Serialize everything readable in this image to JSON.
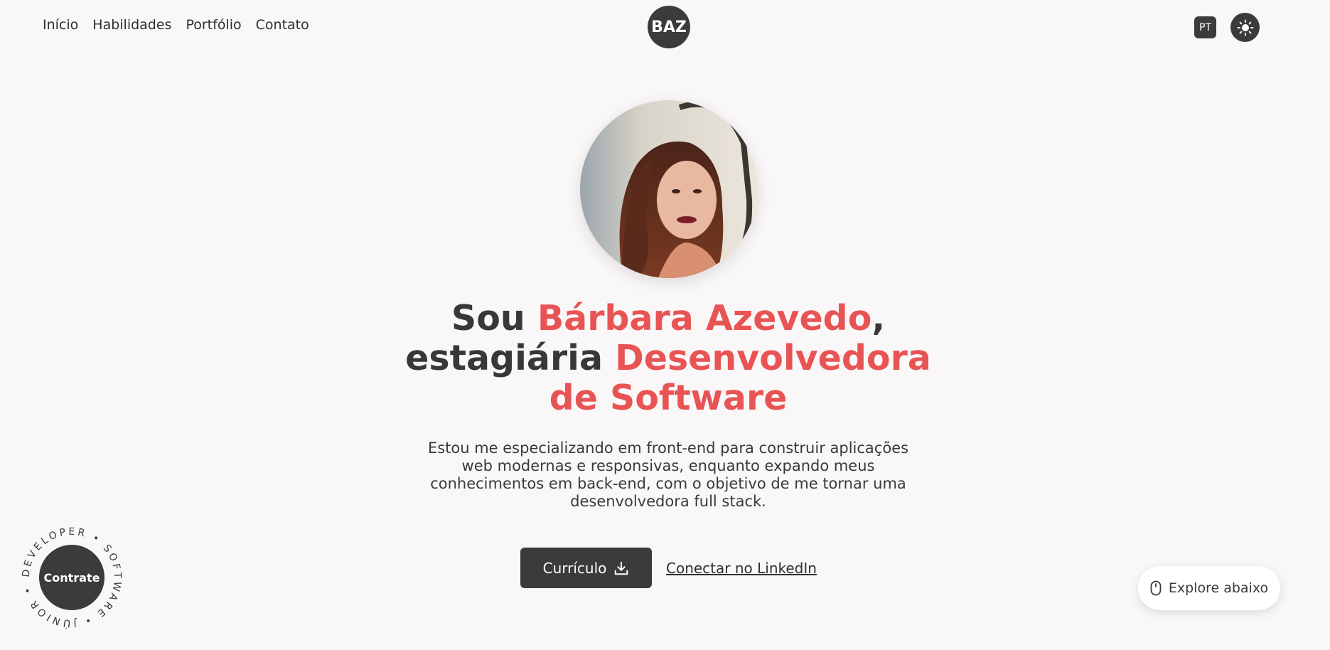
{
  "nav": {
    "items": [
      {
        "label": "Início"
      },
      {
        "label": "Habilidades"
      },
      {
        "label": "Portfólio"
      },
      {
        "label": "Contato"
      }
    ]
  },
  "logo": {
    "text": "BAZ"
  },
  "header": {
    "language_label": "PT",
    "theme_icon": "sun-icon"
  },
  "hero": {
    "headline": {
      "prefix": "Sou ",
      "name": "Bárbara Azevedo",
      "comma": ",",
      "role_prefix": "estagiária ",
      "role": "Desenvolvedora de Software"
    },
    "description": "Estou me especializando em front-end para construir aplicações web modernas e responsivas, enquanto expando meus conhecimentos em back-end, com o objetivo de me tornar uma desenvolvedora full stack.",
    "cv_button": {
      "label": "Currículo",
      "icon": "download-icon"
    },
    "linkedin_link": "Conectar no LinkedIn"
  },
  "badge": {
    "center_label": "Contrate",
    "ring_text": "DEVELOPER • SOFTWARE • JÚNIOR •"
  },
  "explore": {
    "label": "Explore abaixo",
    "icon": "mouse-icon"
  },
  "colors": {
    "background": "#faf7f8",
    "dark": "#3b3b3b",
    "accent": "#e85454"
  }
}
